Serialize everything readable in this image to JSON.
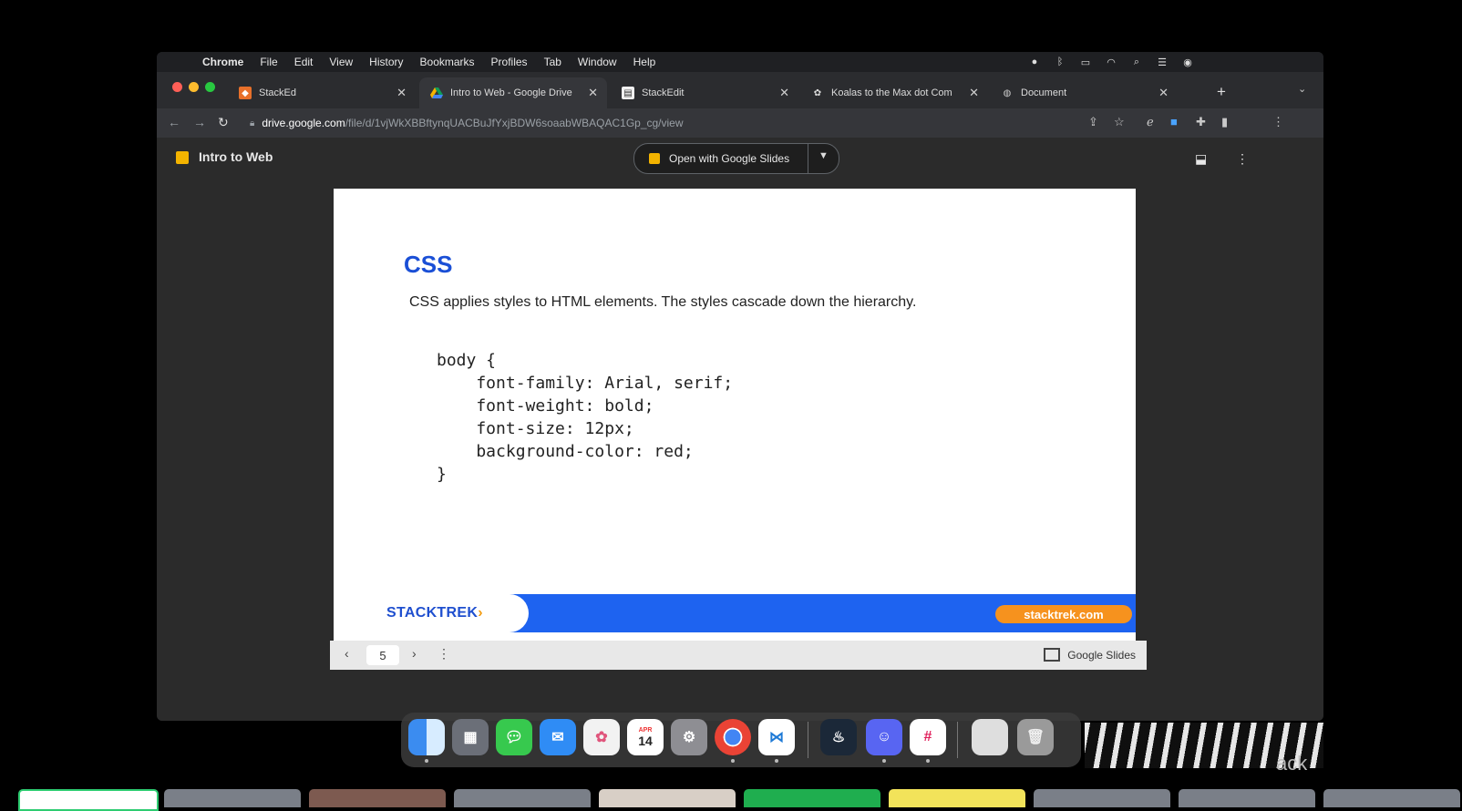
{
  "menubar": {
    "app": "Chrome",
    "items": [
      "File",
      "Edit",
      "View",
      "History",
      "Bookmarks",
      "Profiles",
      "Tab",
      "Window",
      "Help"
    ]
  },
  "tabs": [
    {
      "label": "StackEd",
      "icon": "stacked-favicon",
      "active": false
    },
    {
      "label": "Intro to Web - Google Drive",
      "icon": "google-drive-favicon",
      "active": true
    },
    {
      "label": "StackEdit",
      "icon": "stackedit-favicon",
      "active": false
    },
    {
      "label": "Koalas to the Max dot Com",
      "icon": "koala-favicon",
      "active": false
    },
    {
      "label": "Document",
      "icon": "globe-favicon",
      "active": false
    }
  ],
  "address": {
    "host": "drive.google.com",
    "path": "/file/d/1vjWkXBBftynqUACBuJfYxjBDW6soaabWBAQAC1Gp_cg/view"
  },
  "viewer": {
    "title": "Intro to Web",
    "open_with": "Open with Google Slides"
  },
  "slide": {
    "title": "CSS",
    "subtitle": "CSS applies styles to HTML elements. The styles cascade down the hierarchy.",
    "code": [
      "body {",
      "    font-family: Arial, serif;",
      "    font-weight: bold;",
      "    font-size: 12px;",
      "    background-color: red;",
      "}"
    ],
    "logo": "STACKTREK",
    "logo_arrow": "›",
    "site": "stacktrek.com"
  },
  "slide_controls": {
    "page": "5",
    "app_label": "Google Slides"
  },
  "dock": {
    "calendar_month": "APR",
    "calendar_day": "14"
  },
  "overlay_text": "ack",
  "colors": {
    "slide_title": "#1a4fd6",
    "footer_blue": "#1e63f0",
    "site_orange": "#f6921e",
    "slides_yellow": "#f4b400"
  }
}
